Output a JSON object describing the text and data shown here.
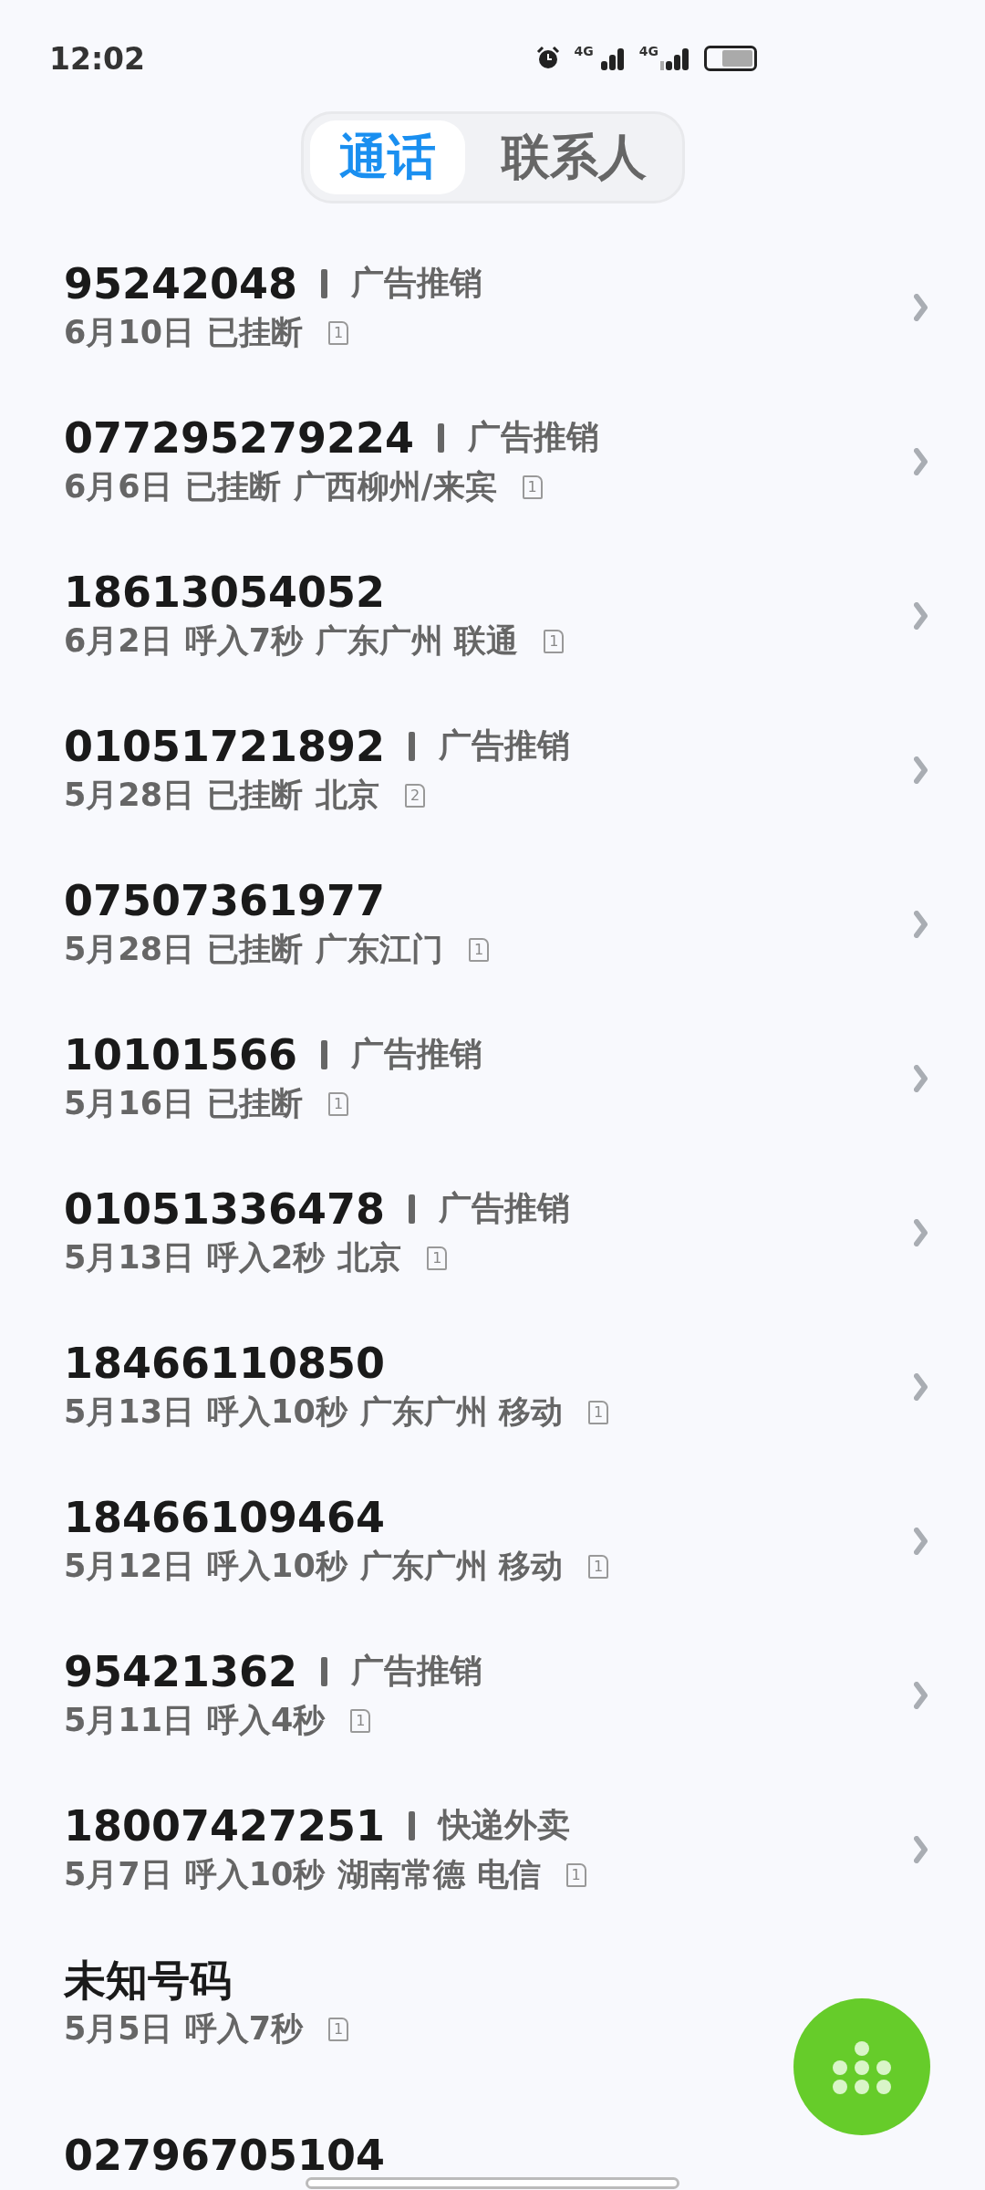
{
  "status_bar": {
    "time": "12:02",
    "network_1": "4G",
    "network_2": "4G"
  },
  "tabs": [
    {
      "label": "通话",
      "selected": true
    },
    {
      "label": "联系人",
      "selected": false
    }
  ],
  "calls": [
    {
      "number": "95242048",
      "tag": "广告推销",
      "date": "6月10日",
      "status": "已挂断",
      "sim": "1",
      "arrow": true
    },
    {
      "number": "077295279224",
      "tag": "广告推销",
      "date": "6月6日",
      "status": "已挂断",
      "location": "广西柳州/来宾",
      "sim": "1",
      "arrow": true
    },
    {
      "number": "18613054052",
      "date": "6月2日",
      "status": "呼入7秒",
      "location": "广东广州 联通",
      "sim": "1",
      "arrow": true
    },
    {
      "number": "01051721892",
      "tag": "广告推销",
      "date": "5月28日",
      "status": "已挂断",
      "location": "北京",
      "sim": "2",
      "arrow": true
    },
    {
      "number": "07507361977",
      "date": "5月28日",
      "status": "已挂断",
      "location": "广东江门",
      "sim": "1",
      "arrow": true
    },
    {
      "number": "10101566",
      "tag": "广告推销",
      "date": "5月16日",
      "status": "已挂断",
      "sim": "1",
      "arrow": true
    },
    {
      "number": "01051336478",
      "tag": "广告推销",
      "date": "5月13日",
      "status": "呼入2秒",
      "location": "北京",
      "sim": "1",
      "arrow": true
    },
    {
      "number": "18466110850",
      "date": "5月13日",
      "status": "呼入10秒",
      "location": "广东广州 移动",
      "sim": "1",
      "arrow": true
    },
    {
      "number": "18466109464",
      "date": "5月12日",
      "status": "呼入10秒",
      "location": "广东广州 移动",
      "sim": "1",
      "arrow": true
    },
    {
      "number": "95421362",
      "tag": "广告推销",
      "date": "5月11日",
      "status": "呼入4秒",
      "sim": "1",
      "arrow": true
    },
    {
      "number": "18007427251",
      "tag": "快递外卖",
      "date": "5月7日",
      "status": "呼入10秒",
      "location": "湖南常德 电信",
      "sim": "1",
      "arrow": true
    },
    {
      "number": "未知号码",
      "date": "5月5日",
      "status": "呼入7秒",
      "sim": "1"
    },
    {
      "number": "02796705104"
    }
  ]
}
